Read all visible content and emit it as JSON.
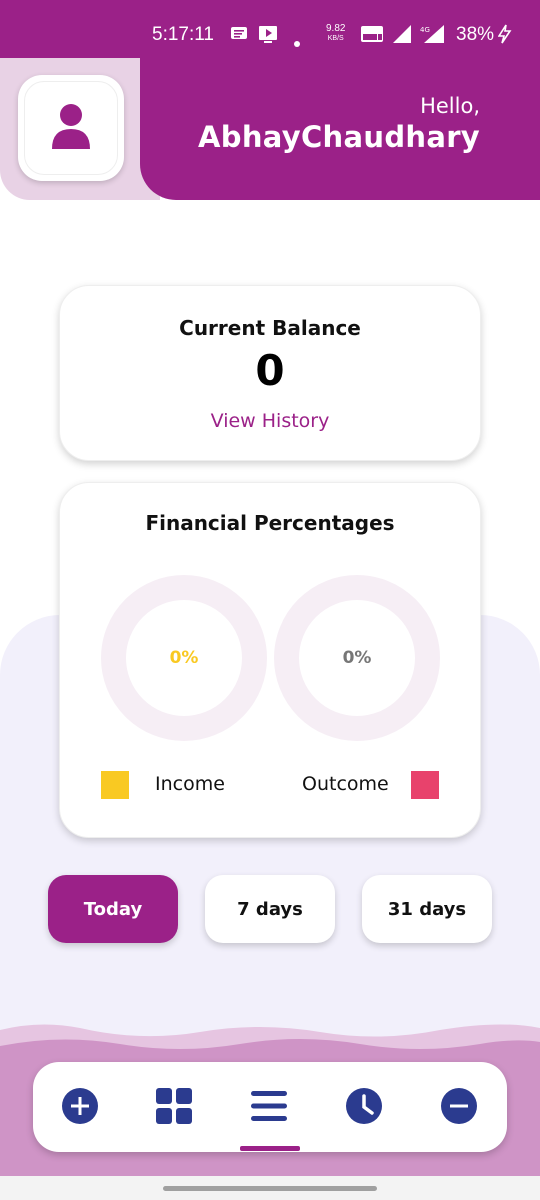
{
  "status_bar": {
    "time": "5:17:11",
    "speed_value": "9.82",
    "speed_unit": "KB/S",
    "battery": "38%"
  },
  "header": {
    "greeting": "Hello,",
    "username": "AbhayChaudhary"
  },
  "balance": {
    "title": "Current Balance",
    "value": "0",
    "history_link": "View History"
  },
  "financial": {
    "title": "Financial Percentages",
    "income_percent": "0%",
    "outcome_percent": "0%",
    "income_label": "Income",
    "outcome_label": "Outcome"
  },
  "periods": [
    {
      "label": "Today",
      "active": true
    },
    {
      "label": "7 days",
      "active": false
    },
    {
      "label": "31 days",
      "active": false
    }
  ],
  "nav": {
    "items": [
      "add-icon",
      "dashboard-icon",
      "menu-icon",
      "clock-icon",
      "remove-icon"
    ],
    "active_index": 2
  },
  "colors": {
    "primary": "#9b2188",
    "income": "#f9c922",
    "outcome": "#e8426c",
    "nav_icon": "#2b3b8f"
  }
}
